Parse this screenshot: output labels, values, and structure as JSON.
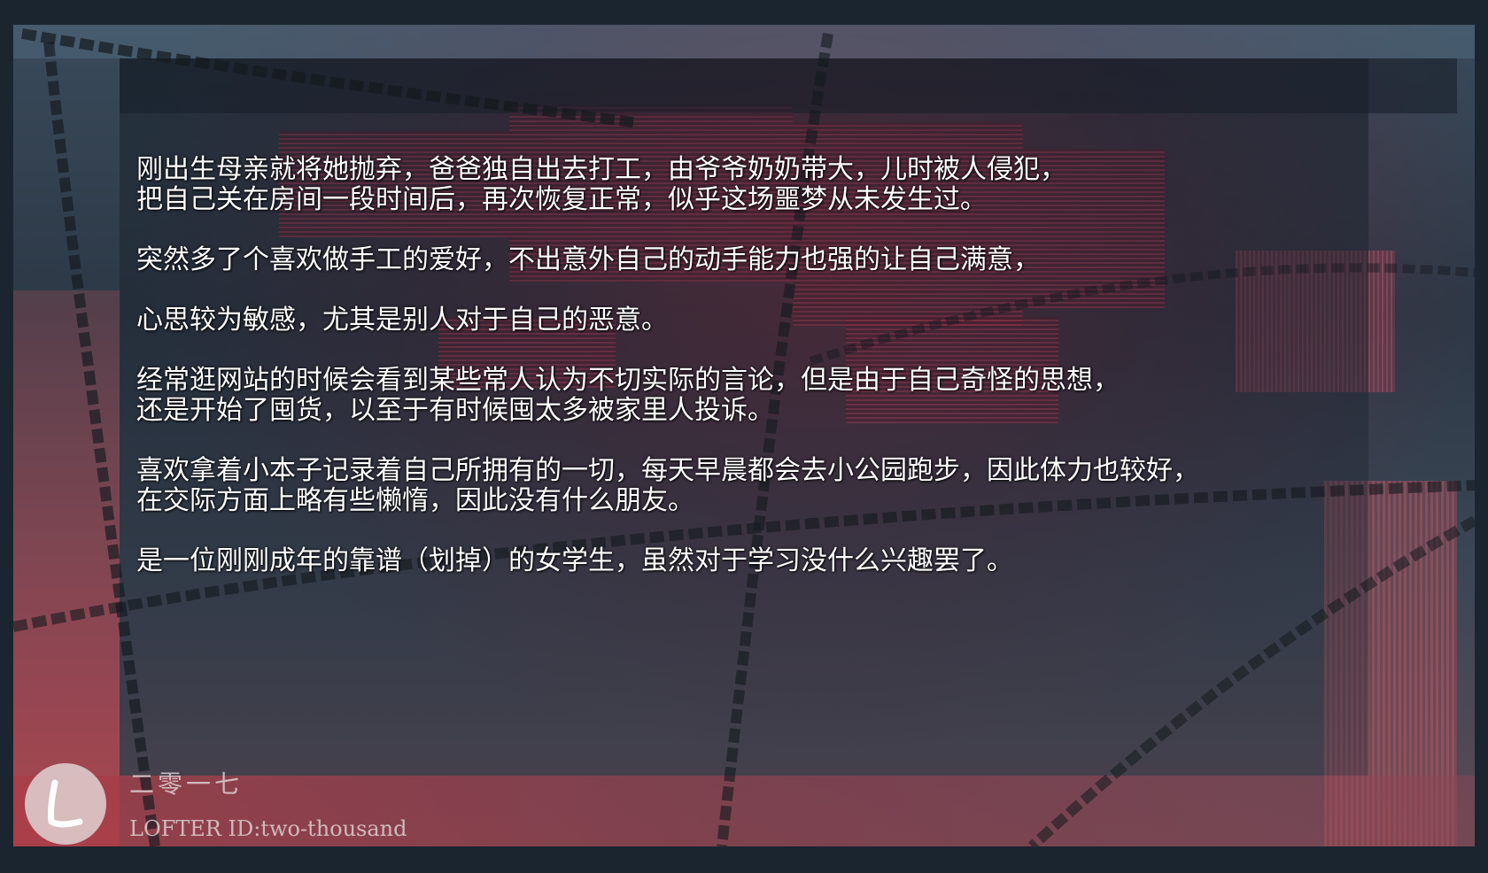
{
  "paragraphs": [
    [
      "刚出生母亲就将她抛弃，爸爸独自出去打工，由爷爷奶奶带大，儿时被人侵犯，",
      "把自己关在房间一段时间后，再次恢复正常，似乎这场噩梦从未发生过。"
    ],
    [
      "突然多了个喜欢做手工的爱好，不出意外自己的动手能力也强的让自己满意，"
    ],
    [
      "心思较为敏感，尤其是别人对于自己的恶意。"
    ],
    [
      "经常逛网站的时候会看到某些常人认为不切实际的言论，但是由于自己奇怪的思想，",
      "还是开始了囤货，以至于有时候囤太多被家里人投诉。"
    ],
    [
      "喜欢拿着小本子记录着自己所拥有的一切，每天早晨都会去小公园跑步，因此体力也较好，",
      "在交际方面上略有些懒惰，因此没有什么朋友。"
    ],
    [
      "是一位刚刚成年的靠谱（划掉）的女学生，虽然对于学习没什么兴趣罢了。"
    ]
  ],
  "watermark": {
    "title": "二零一七",
    "id": "LOFTER ID:two-thousand",
    "logo_icon": "lofter-logo-icon"
  },
  "colors": {
    "page_bg": "#1b2530",
    "text": "#ffffff",
    "accent_red": "#c83c55"
  }
}
